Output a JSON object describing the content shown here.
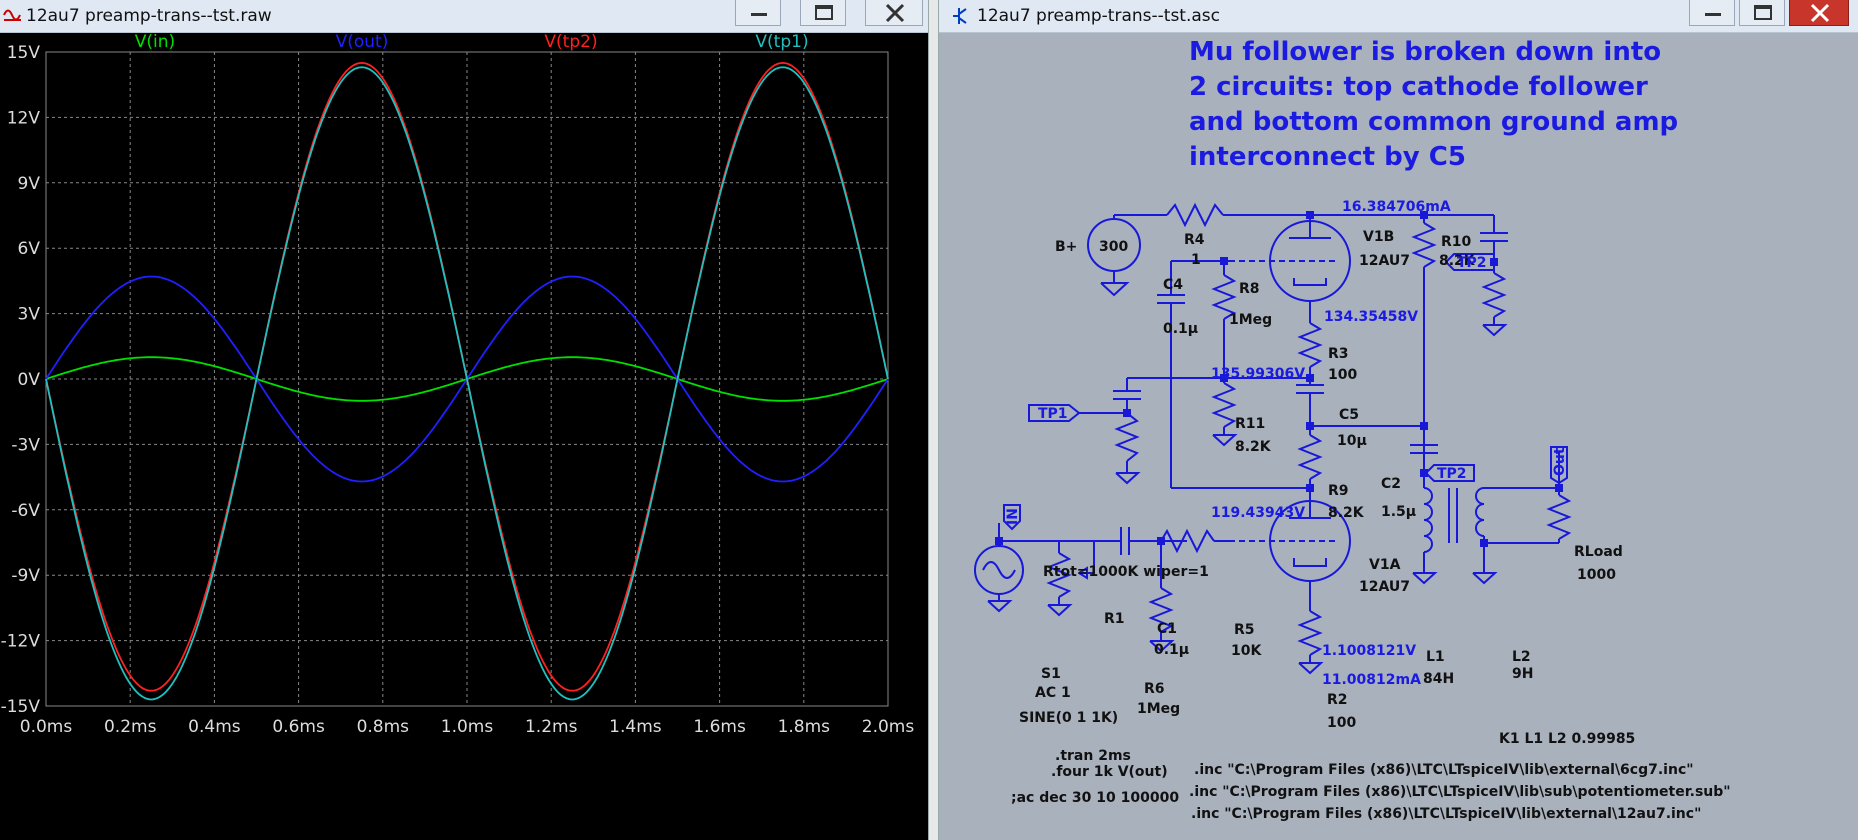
{
  "waveform_window": {
    "title": "12au7 preamp-trans--tst.raw",
    "icon": "waveform-icon"
  },
  "schematic_window": {
    "title": "12au7 preamp-trans--tst.asc",
    "icon": "transistor-icon"
  },
  "window_controls": {
    "minimize": "minimize-icon",
    "maximize": "maximize-icon",
    "close": "close-icon"
  },
  "chart_data": {
    "type": "line",
    "title": "",
    "xlabel": "",
    "ylabel": "",
    "xlim": [
      0,
      2.0
    ],
    "ylim": [
      -15,
      15
    ],
    "grid": true,
    "legend_placement": "top",
    "x_ticks": [
      "0.0ms",
      "0.2ms",
      "0.4ms",
      "0.6ms",
      "0.8ms",
      "1.0ms",
      "1.2ms",
      "1.4ms",
      "1.6ms",
      "1.8ms",
      "2.0ms"
    ],
    "y_ticks": [
      "15V",
      "12V",
      "9V",
      "6V",
      "3V",
      "0V",
      "-3V",
      "-6V",
      "-9V",
      "-12V",
      "-15V"
    ],
    "series": [
      {
        "name": "V(in)",
        "color": "#00e000",
        "amplitude": 1.0,
        "phase": "inverted",
        "x": [
          0,
          0.25,
          0.5,
          0.75,
          1.0,
          1.25,
          1.5,
          1.75,
          2.0
        ],
        "values": [
          0,
          1.0,
          0,
          -1.0,
          0,
          1.0,
          0,
          -1.0,
          0
        ]
      },
      {
        "name": "V(out)",
        "color": "#2020ff",
        "amplitude": 4.7,
        "x": [
          0,
          0.25,
          0.5,
          0.75,
          1.0,
          1.25,
          1.5,
          1.75,
          2.0
        ],
        "values": [
          0,
          4.7,
          0,
          -4.7,
          0,
          4.7,
          0,
          -4.7,
          0
        ]
      },
      {
        "name": "V(tp2)",
        "color": "#ff2020",
        "amplitude": 14.5,
        "x": [
          0,
          0.25,
          0.5,
          0.75,
          1.0,
          1.25,
          1.5,
          1.75,
          2.0
        ],
        "values": [
          0,
          -14.3,
          0,
          14.5,
          0,
          -14.3,
          0,
          14.5,
          0
        ]
      },
      {
        "name": "V(tp1)",
        "color": "#20c0c0",
        "amplitude": 14.7,
        "x": [
          0,
          0.25,
          0.5,
          0.75,
          1.0,
          1.25,
          1.5,
          1.75,
          2.0
        ],
        "values": [
          0,
          -14.7,
          0,
          14.3,
          0,
          -14.7,
          0,
          14.3,
          0
        ]
      }
    ]
  },
  "schematic": {
    "note_lines": [
      "Mu follower is broken down into",
      "2 circuits: top cathode follower",
      "and bottom common ground amp",
      "interconnect by C5"
    ],
    "labels": {
      "bplus": "B+",
      "b_src_val": "300",
      "r4": "R4",
      "r4_val": "1",
      "i_label": "16.384706mA",
      "v1b": "V1B",
      "v1b_val": "12AU7",
      "r10": "R10",
      "r10_val": "8.2K",
      "tp2a": "TP2",
      "c4": "C4",
      "c4_val": "0.1µ",
      "r8": "R8",
      "r8_val": "1Meg",
      "v134": "134.35458V",
      "r3": "R3",
      "r3_val": "100",
      "v135": "135.99306V",
      "tp1": "TP1",
      "r11": "R11",
      "r11_val": "8.2K",
      "c5": "C5",
      "c5_val": "10µ",
      "r9": "R9",
      "r9_val": "8.2K",
      "v119": "119.43943V",
      "c2": "C2",
      "c2_val": "1.5µ",
      "tp2b": "TP2",
      "out": "Out",
      "rload": "RLoad",
      "rload_val": "1000",
      "in": "IN",
      "rtot": "Rtot=1000K wiper=1",
      "r1": "R1",
      "c1": "C1",
      "c1_val": "0.1µ",
      "r5": "R5",
      "r5_val": "10K",
      "v1a": "V1A",
      "v1a_val": "12AU7",
      "v1_100": "1.1008121V",
      "i11": "11.00812mA",
      "r2": "R2",
      "r2_val": "100",
      "l1": "L1",
      "l1_val": "84H",
      "l2": "L2",
      "l2_val": "9H",
      "s1": "S1",
      "s1_ac": "AC 1",
      "s1_sine": "SINE(0 1 1K)",
      "r6": "R6",
      "r6_val": "1Meg",
      "k1": "K1 L1 L2 0.99985",
      "tran": ".tran 2ms",
      "four": ".four 1k V(out)",
      "ac": ";ac dec 30 10 100000",
      "inc1": ".inc \"C:\\Program Files (x86)\\LTC\\LTspiceIV\\lib\\external\\6cg7.inc\"",
      "inc2": ".inc \"C:\\Program Files (x86)\\LTC\\LTspiceIV\\lib\\sub\\potentiometer.sub\"",
      "inc3": ".inc \"C:\\Program Files (x86)\\LTC\\LTspiceIV\\lib\\external\\12au7.inc\""
    }
  }
}
